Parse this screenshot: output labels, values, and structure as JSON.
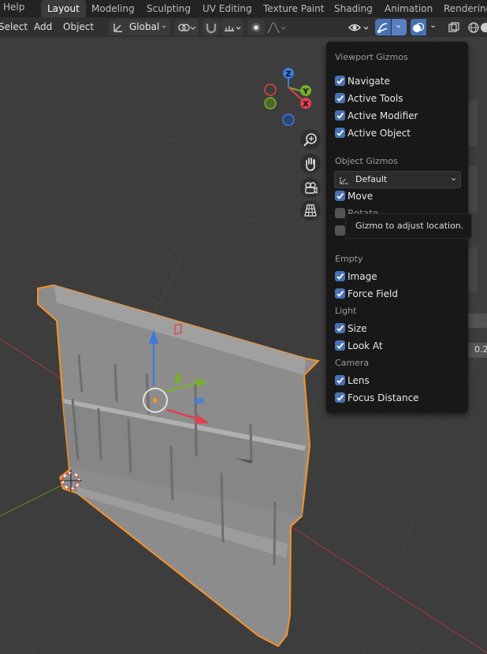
{
  "topbar": {
    "help": "Help",
    "tabs": [
      "Layout",
      "Modeling",
      "Sculpting",
      "UV Editing",
      "Texture Paint",
      "Shading",
      "Animation",
      "Rendering"
    ]
  },
  "header": {
    "menus": [
      "Select",
      "Add",
      "Object"
    ],
    "orientation": "Global"
  },
  "popup": {
    "title": "Viewport Gizmos",
    "viewport_items": [
      {
        "label": "Navigate",
        "checked": true
      },
      {
        "label": "Active Tools",
        "checked": true
      },
      {
        "label": "Active Modifier",
        "checked": true
      },
      {
        "label": "Active Object",
        "checked": true
      }
    ],
    "object_gizmos_title": "Object Gizmos",
    "orientation_dropdown": "Default",
    "object_items": [
      {
        "label": "Move",
        "checked": true
      },
      {
        "label": "Rotate",
        "checked": false
      },
      {
        "label": "",
        "checked": false
      }
    ],
    "empty_title": "Empty",
    "empty_items": [
      {
        "label": "Image",
        "checked": true
      },
      {
        "label": "Force Field",
        "checked": true
      }
    ],
    "light_title": "Light",
    "light_items": [
      {
        "label": "Size",
        "checked": true
      },
      {
        "label": "Look At",
        "checked": true
      }
    ],
    "camera_title": "Camera",
    "camera_items": [
      {
        "label": "Lens",
        "checked": true
      },
      {
        "label": "Focus Distance",
        "checked": true
      }
    ]
  },
  "tooltip": "Gizmo to adjust location.",
  "axes": {
    "z": "Z",
    "y": "Y",
    "x": "X"
  },
  "side_value": "0.2",
  "colors": {
    "accent": "#4772b3",
    "selection_outline": "#f5922a",
    "axis_x": "#e2404f",
    "axis_y": "#7aae2d",
    "axis_z": "#3d7ae0"
  }
}
